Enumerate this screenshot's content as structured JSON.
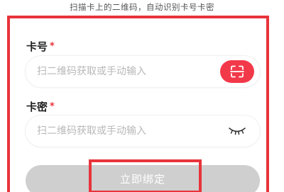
{
  "hint": "扫描卡上的二维码，自动识别卡号卡密",
  "card_number": {
    "label": "卡号",
    "required_mark": "*",
    "placeholder": "扫二维码获取或手动输入",
    "value": "",
    "scan_icon": "scan-icon"
  },
  "card_password": {
    "label": "卡密",
    "required_mark": "*",
    "placeholder": "扫二维码获取或手动输入",
    "value": "",
    "toggle_icon": "eye-closed-icon"
  },
  "submit": {
    "label": "立即绑定"
  },
  "colors": {
    "accent": "#f2394a",
    "highlight": "#e8343b",
    "disabled_button": "#cfcfcf"
  }
}
